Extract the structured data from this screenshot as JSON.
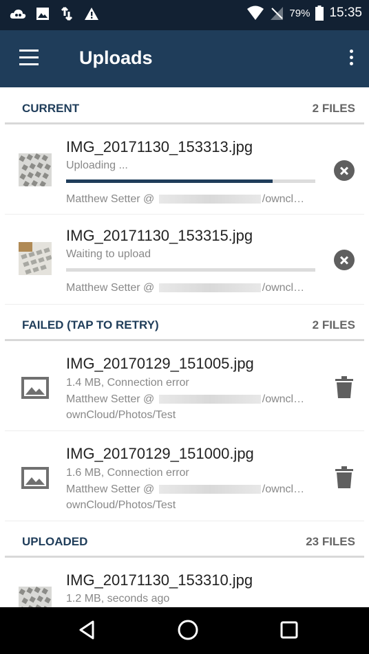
{
  "status_bar": {
    "battery": "79%",
    "time": "15:35"
  },
  "app_bar": {
    "title": "Uploads"
  },
  "sections": [
    {
      "title": "CURRENT",
      "count": "2 FILES",
      "items": [
        {
          "name": "IMG_20171130_153313.jpg",
          "status": "Uploading ...",
          "progress": 0.83,
          "account_prefix": "Matthew Setter @",
          "account_suffix": "/owncl…"
        },
        {
          "name": "IMG_20171130_153315.jpg",
          "status": "Waiting to upload",
          "progress": 0,
          "account_prefix": "Matthew Setter @",
          "account_suffix": "/owncl…"
        }
      ]
    },
    {
      "title": "FAILED (TAP TO RETRY)",
      "count": "2 FILES",
      "items": [
        {
          "name": "IMG_20170129_151005.jpg",
          "status": "1.4 MB, Connection error",
          "account_prefix": "Matthew Setter @",
          "account_suffix": "/owncl…",
          "path": "ownCloud/Photos/Test"
        },
        {
          "name": "IMG_20170129_151000.jpg",
          "status": "1.6 MB, Connection error",
          "account_prefix": "Matthew Setter @",
          "account_suffix": "/owncl…",
          "path": "ownCloud/Photos/Test"
        }
      ]
    },
    {
      "title": "UPLOADED",
      "count": "23 FILES",
      "items": [
        {
          "name": "IMG_20171130_153310.jpg",
          "status": "1.2 MB,  seconds ago"
        }
      ]
    }
  ],
  "colors": {
    "status_bar": "#122133",
    "app_bar": "#1f3d5a",
    "accent": "#1f3d5a"
  }
}
